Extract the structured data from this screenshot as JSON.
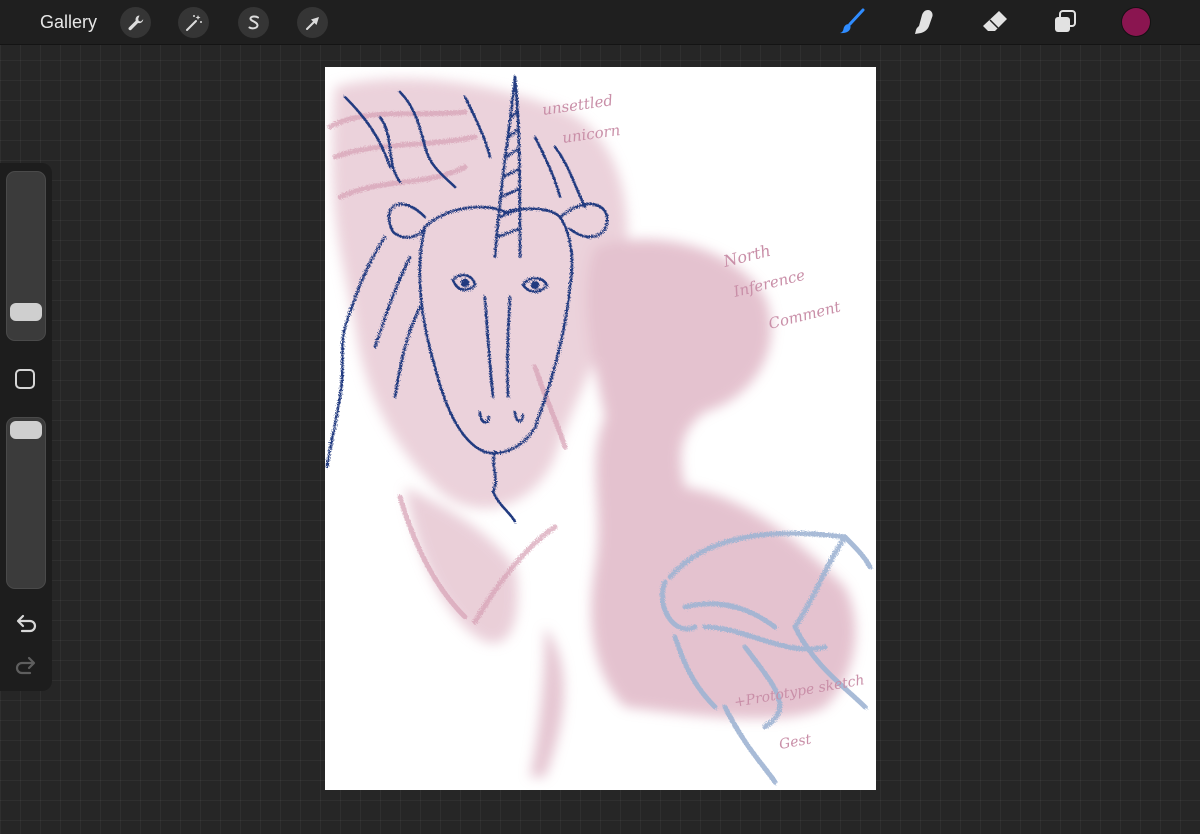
{
  "app": {
    "gallery_label": "Gallery"
  },
  "toolbar": {
    "left_tools": [
      {
        "name": "actions",
        "icon": "wrench-icon"
      },
      {
        "name": "adjustments",
        "icon": "magic-wand-icon"
      },
      {
        "name": "selection",
        "icon": "selection-s-icon"
      },
      {
        "name": "transform",
        "icon": "arrow-cursor-icon"
      }
    ],
    "right_tools": [
      {
        "name": "brush",
        "icon": "brush-icon",
        "active": true
      },
      {
        "name": "smudge",
        "icon": "smudge-finger-icon",
        "active": false
      },
      {
        "name": "eraser",
        "icon": "eraser-icon",
        "active": false
      },
      {
        "name": "layers",
        "icon": "layers-icon",
        "active": false
      }
    ],
    "current_color": "#8a1550",
    "active_tool_color": "#2f8cff"
  },
  "sidebar": {
    "brush_size_level": 0.12,
    "opacity_level": 1.0,
    "modify_icon": "square-icon",
    "undo_icon": "undo-icon",
    "redo_icon": "redo-icon"
  },
  "canvas": {
    "notes": [
      {
        "text": "unsettled unicorn"
      },
      {
        "text": "North Inference Comment"
      },
      {
        "text": "+Prototype sketch Gest"
      }
    ],
    "colors": {
      "pink": "#d9a7b9",
      "navy": "#243a80",
      "light_blue": "#9fb4d3",
      "note_pink": "#c98fa8"
    }
  }
}
